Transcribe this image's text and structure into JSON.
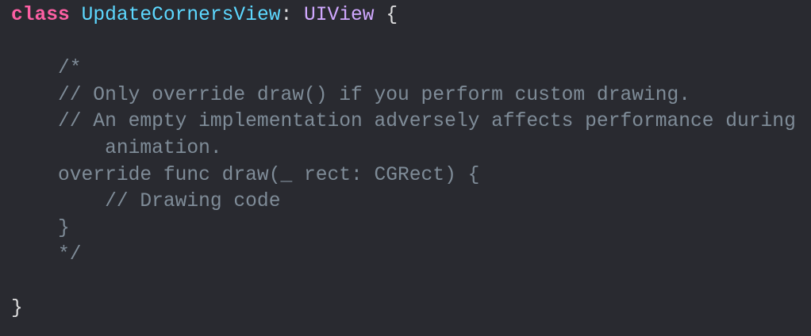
{
  "colors": {
    "background": "#292a30",
    "keyword": "#fc5fa3",
    "class_name": "#5dd8ff",
    "type_name": "#d0a8ff",
    "comment": "#7f8c98",
    "plain": "#dfdfe0"
  },
  "code_lines": [
    [
      {
        "t": "kw",
        "s": "class"
      },
      {
        "t": "plain",
        "s": " "
      },
      {
        "t": "cls",
        "s": "UpdateCornersView"
      },
      {
        "t": "plain",
        "s": ": "
      },
      {
        "t": "type",
        "s": "UIView"
      },
      {
        "t": "plain",
        "s": " {"
      }
    ],
    [],
    [
      {
        "t": "cmt",
        "s": "    /*"
      }
    ],
    [
      {
        "t": "cmt",
        "s": "    // Only override draw() if you perform custom drawing."
      }
    ],
    [
      {
        "t": "cmt",
        "s": "    // An empty implementation adversely affects performance during"
      }
    ],
    [
      {
        "t": "cmt",
        "s": "        animation."
      }
    ],
    [
      {
        "t": "cmt",
        "s": "    override func draw(_ rect: CGRect) {"
      }
    ],
    [
      {
        "t": "cmt",
        "s": "        // Drawing code"
      }
    ],
    [
      {
        "t": "cmt",
        "s": "    }"
      }
    ],
    [
      {
        "t": "cmt",
        "s": "    */"
      }
    ],
    [],
    [
      {
        "t": "plain",
        "s": "}"
      }
    ]
  ]
}
